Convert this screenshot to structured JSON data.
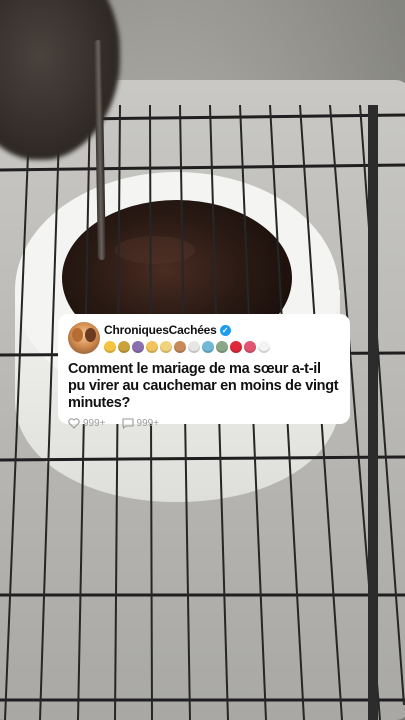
{
  "post": {
    "username": "ChroniquesCachées",
    "verified_symbol": "✓",
    "question": "Comment le mariage de ma sœur a-t-il pu virer au cauchemar en moins de vingt minutes?",
    "likes": "999+",
    "comments": "999+"
  },
  "emojis": [
    {
      "name": "light-bulb-emoji",
      "color": "#f5c542"
    },
    {
      "name": "key-emoji",
      "color": "#c9a33a"
    },
    {
      "name": "wizard-emoji",
      "color": "#8b6fb0"
    },
    {
      "name": "angel-emoji",
      "color": "#f2c35c"
    },
    {
      "name": "unamused-face-emoji",
      "color": "#f0d37a"
    },
    {
      "name": "frowning-emoji",
      "color": "#c98a5a"
    },
    {
      "name": "skull-emoji",
      "color": "#e6e6e6"
    },
    {
      "name": "cool-face-emoji",
      "color": "#6fb8d6"
    },
    {
      "name": "zombie-emoji",
      "color": "#89a88a"
    },
    {
      "name": "red-heart-emoji",
      "color": "#e0293a"
    },
    {
      "name": "heart-bandage-emoji",
      "color": "#e25570"
    },
    {
      "name": "ghost-emoji",
      "color": "#f4f4f4"
    }
  ],
  "colors": {
    "chocolate": "#2a1a14",
    "cake": "#ececea",
    "rack": "#1f1f1f",
    "verified_blue": "#1d9bf0"
  }
}
